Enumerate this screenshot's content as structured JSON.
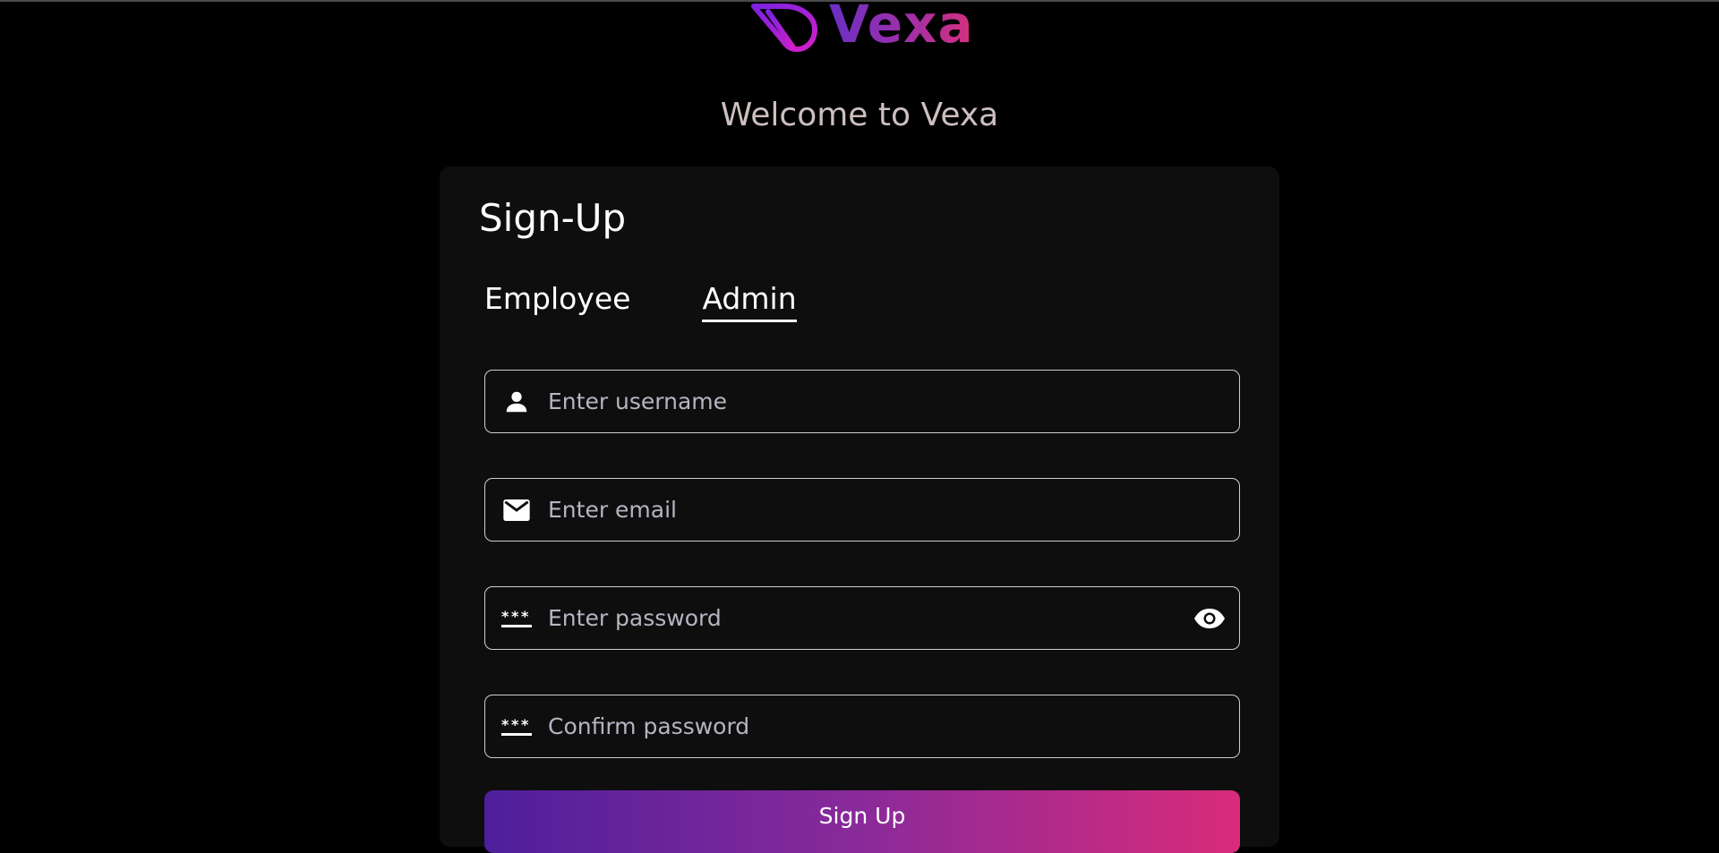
{
  "brand": {
    "name": "Vexa",
    "logo_icon": "vexa-logo-mark",
    "gradient": [
      "#6a2fc4",
      "#d6307a"
    ]
  },
  "welcome_text": "Welcome to Vexa",
  "form": {
    "title": "Sign-Up",
    "tabs": [
      {
        "label": "Employee",
        "active": false
      },
      {
        "label": "Admin",
        "active": true
      }
    ],
    "fields": {
      "username": {
        "placeholder": "Enter username",
        "icon": "user-icon"
      },
      "email": {
        "placeholder": "Enter email",
        "icon": "mail-icon"
      },
      "password": {
        "placeholder": "Enter password",
        "icon": "password-icon",
        "toggle_icon": "eye-icon"
      },
      "confirm_password": {
        "placeholder": "Confirm password",
        "icon": "password-icon"
      }
    },
    "submit_label": "Sign Up"
  },
  "colors": {
    "background": "#000000",
    "card": "#0e0e0e",
    "accent_start": "#4e1f9c",
    "accent_end": "#d92b7a"
  }
}
